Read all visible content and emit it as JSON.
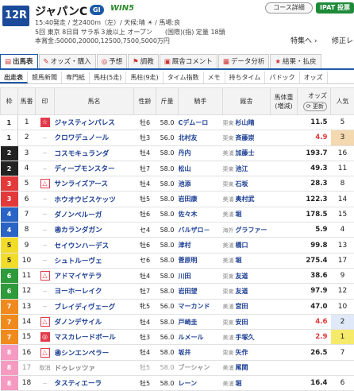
{
  "race": {
    "number": "12R",
    "name": "ジャパンC",
    "grade": "GI",
    "win5": "WIN5",
    "info_line1": "15:40発走 / 芝2400m（左）/ 天候:晴 ☀ / 馬場:良",
    "info_line2": "5回 東京 8日目 サラ系３歳以上 オープン　　(国際)(指) 定量 18頭",
    "info_line3": "本賞金:50000,20000,12500,7500,5000万円",
    "course_btn": "コース詳細",
    "ipat_btn": "IPAT 投票",
    "special_link": "特集へ ›",
    "next_link": "修正レース"
  },
  "tabs": [
    {
      "label": "出馬表",
      "active": true
    },
    {
      "label": "オッズ・購入",
      "active": false
    },
    {
      "label": "予想",
      "active": false
    },
    {
      "label": "調教",
      "active": false
    },
    {
      "label": "厩舎コメント",
      "active": false
    },
    {
      "label": "データ分析",
      "active": false
    },
    {
      "label": "結果・払戻",
      "active": false
    }
  ],
  "subtabs": [
    "出走表",
    "競馬新聞",
    "専門紙",
    "馬柱(5走)",
    "馬柱(9走)",
    "タイム指数",
    "メモ",
    "持ちタイム",
    "パドック",
    "オッズ"
  ],
  "columns": {
    "waku": "枠",
    "umaban": "馬番",
    "mark": "印",
    "name": "馬名",
    "sex": "性齢",
    "weight": "斤量",
    "jockey": "騎手",
    "trainer": "厩舎",
    "horse_weight": "馬体重(増減)",
    "odds": "オッズ",
    "odds_update": "更新",
    "pop": "人気"
  },
  "colors": {
    "waku": [
      "#ffffff",
      "#222222",
      "#e23a3a",
      "#2a64c4",
      "#f2dc2a",
      "#2f9a3a",
      "#f08a1c",
      "#f59ac0"
    ],
    "odds_hot": "#e23a3a",
    "pop_hi": "#f6ea6a"
  },
  "horses": [
    {
      "waku": 1,
      "umaban": "1",
      "mark": "☆",
      "mark_type": "red",
      "name": "ジャスティンパレス",
      "sex": "牡6",
      "weight": "58.0",
      "jockey": "Cデムーロ",
      "area": "栗東",
      "trainer": "杉山晴",
      "odds": "11.5",
      "pop": "5",
      "hot": false
    },
    {
      "waku": 1,
      "umaban": "2",
      "mark": "--",
      "mark_type": "none",
      "name": "クロワデュノール",
      "sex": "牡3",
      "weight": "56.0",
      "jockey": "北村友",
      "area": "栗東",
      "trainer": "斉藤崇",
      "odds": "4.9",
      "pop": "3",
      "hot": true
    },
    {
      "waku": 2,
      "umaban": "3",
      "mark": "--",
      "mark_type": "none",
      "name": "コスモキュランダ",
      "sex": "牡4",
      "weight": "58.0",
      "jockey": "丹内",
      "area": "美浦",
      "trainer": "加藤士",
      "odds": "193.7",
      "pop": "16",
      "hot": false
    },
    {
      "waku": 2,
      "umaban": "4",
      "mark": "--",
      "mark_type": "none",
      "name": "ディープモンスター",
      "sex": "牡7",
      "weight": "58.0",
      "jockey": "松山",
      "area": "栗東",
      "trainer": "池江",
      "odds": "49.3",
      "pop": "11",
      "hot": false
    },
    {
      "waku": 3,
      "umaban": "5",
      "mark": "△",
      "mark_type": "tri",
      "name": "サンライズアース",
      "sex": "牡4",
      "weight": "58.0",
      "jockey": "池添",
      "area": "栗東",
      "trainer": "石坂",
      "odds": "28.3",
      "pop": "8",
      "hot": false
    },
    {
      "waku": 3,
      "umaban": "6",
      "mark": "--",
      "mark_type": "none",
      "name": "ホウオウビスケッツ",
      "sex": "牡5",
      "weight": "58.0",
      "jockey": "岩田康",
      "area": "美浦",
      "trainer": "奥村武",
      "odds": "122.3",
      "pop": "14",
      "hot": false
    },
    {
      "waku": 4,
      "umaban": "7",
      "mark": "--",
      "mark_type": "none",
      "name": "ダノンベルーガ",
      "sex": "牡6",
      "weight": "58.0",
      "jockey": "佐々木",
      "area": "美浦",
      "trainer": "堀",
      "odds": "178.5",
      "pop": "15",
      "hot": false
    },
    {
      "waku": 4,
      "umaban": "8",
      "mark": "--",
      "mark_type": "none",
      "name": "㊜カランダガン",
      "sex": "セ4",
      "weight": "58.0",
      "jockey": "バルザロ－",
      "area": "海外",
      "trainer": "グラファー",
      "odds": "5.9",
      "pop": "4",
      "hot": false
    },
    {
      "waku": 5,
      "umaban": "9",
      "mark": "--",
      "mark_type": "none",
      "name": "セイウンハーデス",
      "sex": "牡6",
      "weight": "58.0",
      "jockey": "津村",
      "area": "美浦",
      "trainer": "橋口",
      "odds": "99.8",
      "pop": "13",
      "hot": false
    },
    {
      "waku": 5,
      "umaban": "10",
      "mark": "--",
      "mark_type": "none",
      "name": "シュトルーヴェ",
      "sex": "セ6",
      "weight": "58.0",
      "jockey": "菅原明",
      "area": "美浦",
      "trainer": "堀",
      "odds": "275.4",
      "pop": "17",
      "hot": false
    },
    {
      "waku": 6,
      "umaban": "11",
      "mark": "△",
      "mark_type": "tri",
      "name": "アドマイヤテラ",
      "sex": "牡4",
      "weight": "58.0",
      "jockey": "川田",
      "area": "栗東",
      "trainer": "友道",
      "odds": "38.6",
      "pop": "9",
      "hot": false
    },
    {
      "waku": 6,
      "umaban": "12",
      "mark": "--",
      "mark_type": "none",
      "name": "ヨーホーレイク",
      "sex": "牡7",
      "weight": "58.0",
      "jockey": "岩田望",
      "area": "栗東",
      "trainer": "友道",
      "odds": "97.9",
      "pop": "12",
      "hot": false
    },
    {
      "waku": 7,
      "umaban": "13",
      "mark": "--",
      "mark_type": "none",
      "name": "ブレイディヴェーグ",
      "sex": "牝5",
      "weight": "56.0",
      "jockey": "マーカンド",
      "area": "美浦",
      "trainer": "宮田",
      "odds": "47.0",
      "pop": "10",
      "hot": false
    },
    {
      "waku": 7,
      "umaban": "14",
      "mark": "△",
      "mark_type": "tri",
      "name": "ダノンデサイル",
      "sex": "牡4",
      "weight": "58.0",
      "jockey": "戸崎圭",
      "area": "栗東",
      "trainer": "安田",
      "odds": "4.6",
      "pop": "2",
      "hot": true
    },
    {
      "waku": 7,
      "umaban": "15",
      "mark": "◎",
      "mark_type": "red",
      "name": "マスカレードボール",
      "sex": "牡3",
      "weight": "56.0",
      "jockey": "ルメール",
      "area": "美浦",
      "trainer": "手塚久",
      "odds": "2.9",
      "pop": "1",
      "hot": true
    },
    {
      "waku": 8,
      "umaban": "16",
      "mark": "△",
      "mark_type": "tri",
      "name": "㊜シンエンペラー",
      "sex": "牡4",
      "weight": "58.0",
      "jockey": "坂井",
      "area": "栗東",
      "trainer": "矢作",
      "odds": "26.5",
      "pop": "7",
      "hot": false
    },
    {
      "waku": 8,
      "umaban": "17",
      "mark": "取消",
      "mark_type": "none",
      "name": "ドゥレッツァ",
      "sex": "牡5",
      "weight": "58.0",
      "jockey": "ブーシャン",
      "area": "美浦",
      "trainer": "尾関",
      "odds": "",
      "pop": "",
      "hot": false,
      "scratched": true
    },
    {
      "waku": 8,
      "umaban": "18",
      "mark": "--",
      "mark_type": "none",
      "name": "タスティエーラ",
      "sex": "牡5",
      "weight": "58.0",
      "jockey": "レーン",
      "area": "美浦",
      "trainer": "堀",
      "odds": "16.4",
      "pop": "6",
      "hot": false
    }
  ]
}
